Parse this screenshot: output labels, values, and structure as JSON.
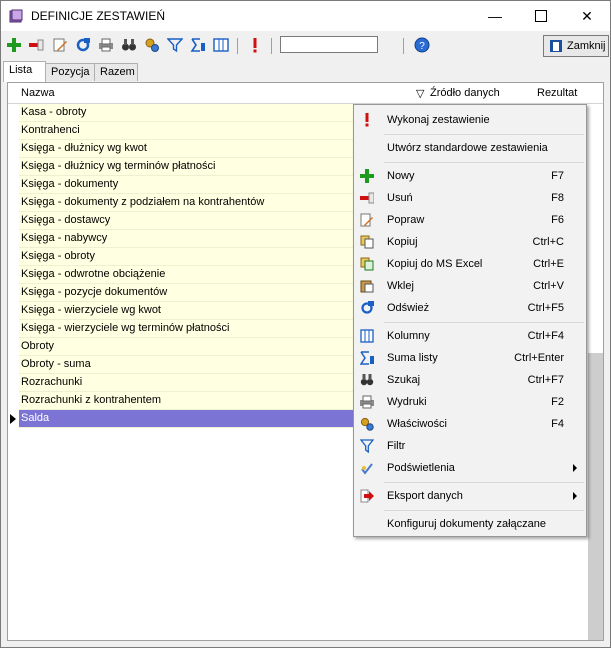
{
  "window": {
    "title": "DEFINICJE ZESTAWIEŃ"
  },
  "toolbar": {
    "search_value": "",
    "close_label": "Zamknij"
  },
  "tabs": [
    {
      "label": "Lista"
    },
    {
      "label": "Pozycja"
    },
    {
      "label": "Razem"
    }
  ],
  "grid": {
    "columns": [
      "Nazwa",
      "Źródło danych",
      "Rezultat"
    ],
    "rows": [
      "Kasa - obroty",
      "Kontrahenci",
      "Księga - dłużnicy wg kwot",
      "Księga - dłużnicy wg terminów płatności",
      "Księga - dokumenty",
      "Księga - dokumenty z podziałem na kontrahentów",
      "Księga - dostawcy",
      "Księga - nabywcy",
      "Księga - obroty",
      "Księga - odwrotne obciążenie",
      "Księga - pozycje dokumentów",
      "Księga - wierzyciele wg kwot",
      "Księga - wierzyciele wg terminów płatności",
      "Obroty",
      "Obroty - suma",
      "Rozrachunki",
      "Rozrachunki z kontrahentem",
      "Salda"
    ],
    "selected_row": "Salda"
  },
  "menu": {
    "items": [
      {
        "label": "Wykonaj zestawienie",
        "shortcut": ""
      },
      {
        "label": "Utwórz standardowe zestawienia",
        "shortcut": ""
      },
      {
        "label": "Nowy",
        "shortcut": "F7"
      },
      {
        "label": "Usuń",
        "shortcut": "F8"
      },
      {
        "label": "Popraw",
        "shortcut": "F6"
      },
      {
        "label": "Kopiuj",
        "shortcut": "Ctrl+C"
      },
      {
        "label": "Kopiuj do MS Excel",
        "shortcut": "Ctrl+E"
      },
      {
        "label": "Wklej",
        "shortcut": "Ctrl+V"
      },
      {
        "label": "Odśwież",
        "shortcut": "Ctrl+F5"
      },
      {
        "label": "Kolumny",
        "shortcut": "Ctrl+F4"
      },
      {
        "label": "Suma listy",
        "shortcut": "Ctrl+Enter"
      },
      {
        "label": "Szukaj",
        "shortcut": "Ctrl+F7"
      },
      {
        "label": "Wydruki",
        "shortcut": "F2"
      },
      {
        "label": "Właściwości",
        "shortcut": "F4"
      },
      {
        "label": "Filtr",
        "shortcut": ""
      },
      {
        "label": "Podświetlenia",
        "shortcut": ""
      },
      {
        "label": "Eksport danych",
        "shortcut": ""
      },
      {
        "label": "Konfiguruj dokumenty załączane",
        "shortcut": ""
      }
    ]
  },
  "colors": {
    "selection": "#7b74d4",
    "row_bg": "#ffffe1",
    "accent_red": "#d01010"
  }
}
